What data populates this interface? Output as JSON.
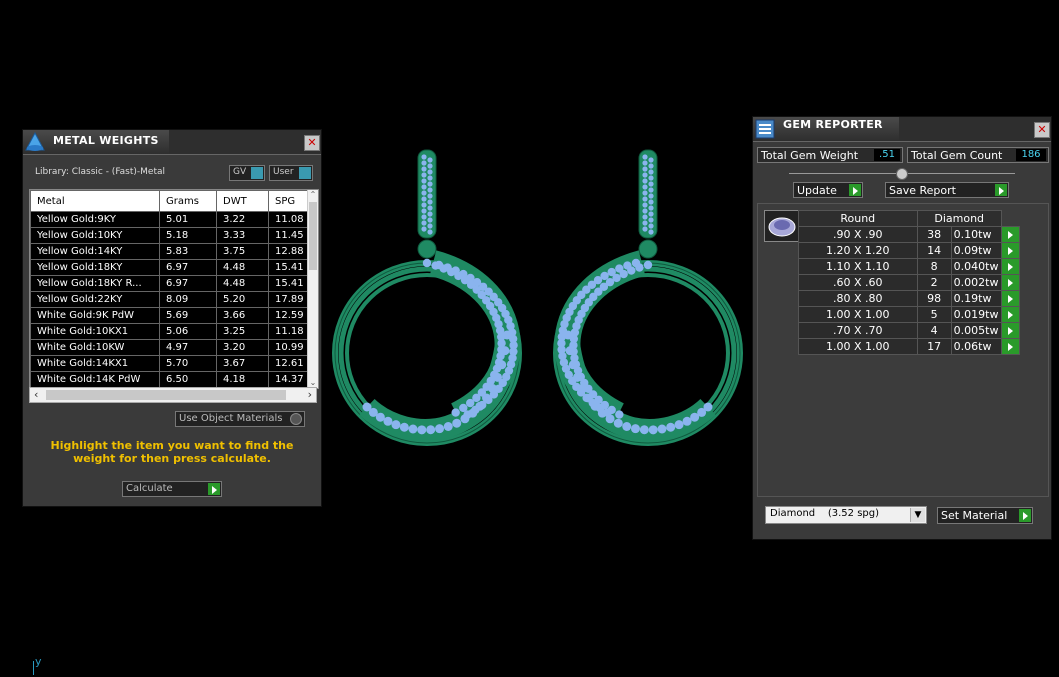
{
  "metal_weights": {
    "title": "METAL WEIGHTS",
    "library_label": "Library: Classic - (Fast)-Metal",
    "gv_label": "GV",
    "user_label": "User",
    "columns": [
      "Metal",
      "Grams",
      "DWT",
      "SPG"
    ],
    "rows": [
      {
        "metal": "Yellow Gold:9KY",
        "grams": "5.01",
        "dwt": "3.22",
        "spg": "11.08"
      },
      {
        "metal": "Yellow Gold:10KY",
        "grams": "5.18",
        "dwt": "3.33",
        "spg": "11.45"
      },
      {
        "metal": "Yellow Gold:14KY",
        "grams": "5.83",
        "dwt": "3.75",
        "spg": "12.88"
      },
      {
        "metal": "Yellow Gold:18KY",
        "grams": "6.97",
        "dwt": "4.48",
        "spg": "15.41"
      },
      {
        "metal": "Yellow Gold:18KY R...",
        "grams": "6.97",
        "dwt": "4.48",
        "spg": "15.41"
      },
      {
        "metal": "Yellow Gold:22KY",
        "grams": "8.09",
        "dwt": "5.20",
        "spg": "17.89"
      },
      {
        "metal": "White Gold:9K PdW",
        "grams": "5.69",
        "dwt": "3.66",
        "spg": "12.59"
      },
      {
        "metal": "White Gold:10KX1",
        "grams": "5.06",
        "dwt": "3.25",
        "spg": "11.18"
      },
      {
        "metal": "White Gold:10KW",
        "grams": "4.97",
        "dwt": "3.20",
        "spg": "10.99"
      },
      {
        "metal": "White Gold:14KX1",
        "grams": "5.70",
        "dwt": "3.67",
        "spg": "12.61"
      },
      {
        "metal": "White Gold:14K PdW",
        "grams": "6.50",
        "dwt": "4.18",
        "spg": "14.37"
      }
    ],
    "use_object_materials": "Use Object Materials",
    "instruction": "Highlight the item you want to find the weight for then press calculate.",
    "calculate_label": "Calculate"
  },
  "gem_reporter": {
    "title": "GEM REPORTER",
    "total_weight_label": "Total Gem Weight",
    "total_weight_value": ".51",
    "total_count_label": "Total Gem Count",
    "total_count_value": "186",
    "update_label": "Update",
    "save_report_label": "Save Report",
    "shape_header": "Round",
    "material_header": "Diamond",
    "rows": [
      {
        "size": ".90 X .90",
        "count": "38",
        "weight": "0.10tw"
      },
      {
        "size": "1.20 X 1.20",
        "count": "14",
        "weight": "0.09tw"
      },
      {
        "size": "1.10 X 1.10",
        "count": "8",
        "weight": "0.040tw"
      },
      {
        "size": ".60 X .60",
        "count": "2",
        "weight": "0.002tw"
      },
      {
        "size": ".80 X .80",
        "count": "98",
        "weight": "0.19tw"
      },
      {
        "size": "1.00 X 1.00",
        "count": "5",
        "weight": "0.019tw"
      },
      {
        "size": ".70 X .70",
        "count": "4",
        "weight": "0.005tw"
      },
      {
        "size": "1.00 X 1.00",
        "count": "17",
        "weight": "0.06tw"
      }
    ],
    "material_select": "Diamond    (3.52 spg)",
    "set_material_label": "Set Material"
  },
  "viewport": {
    "axis_label": "y",
    "metal_color": "#1f8a63",
    "gem_color": "#8ab4ee"
  }
}
